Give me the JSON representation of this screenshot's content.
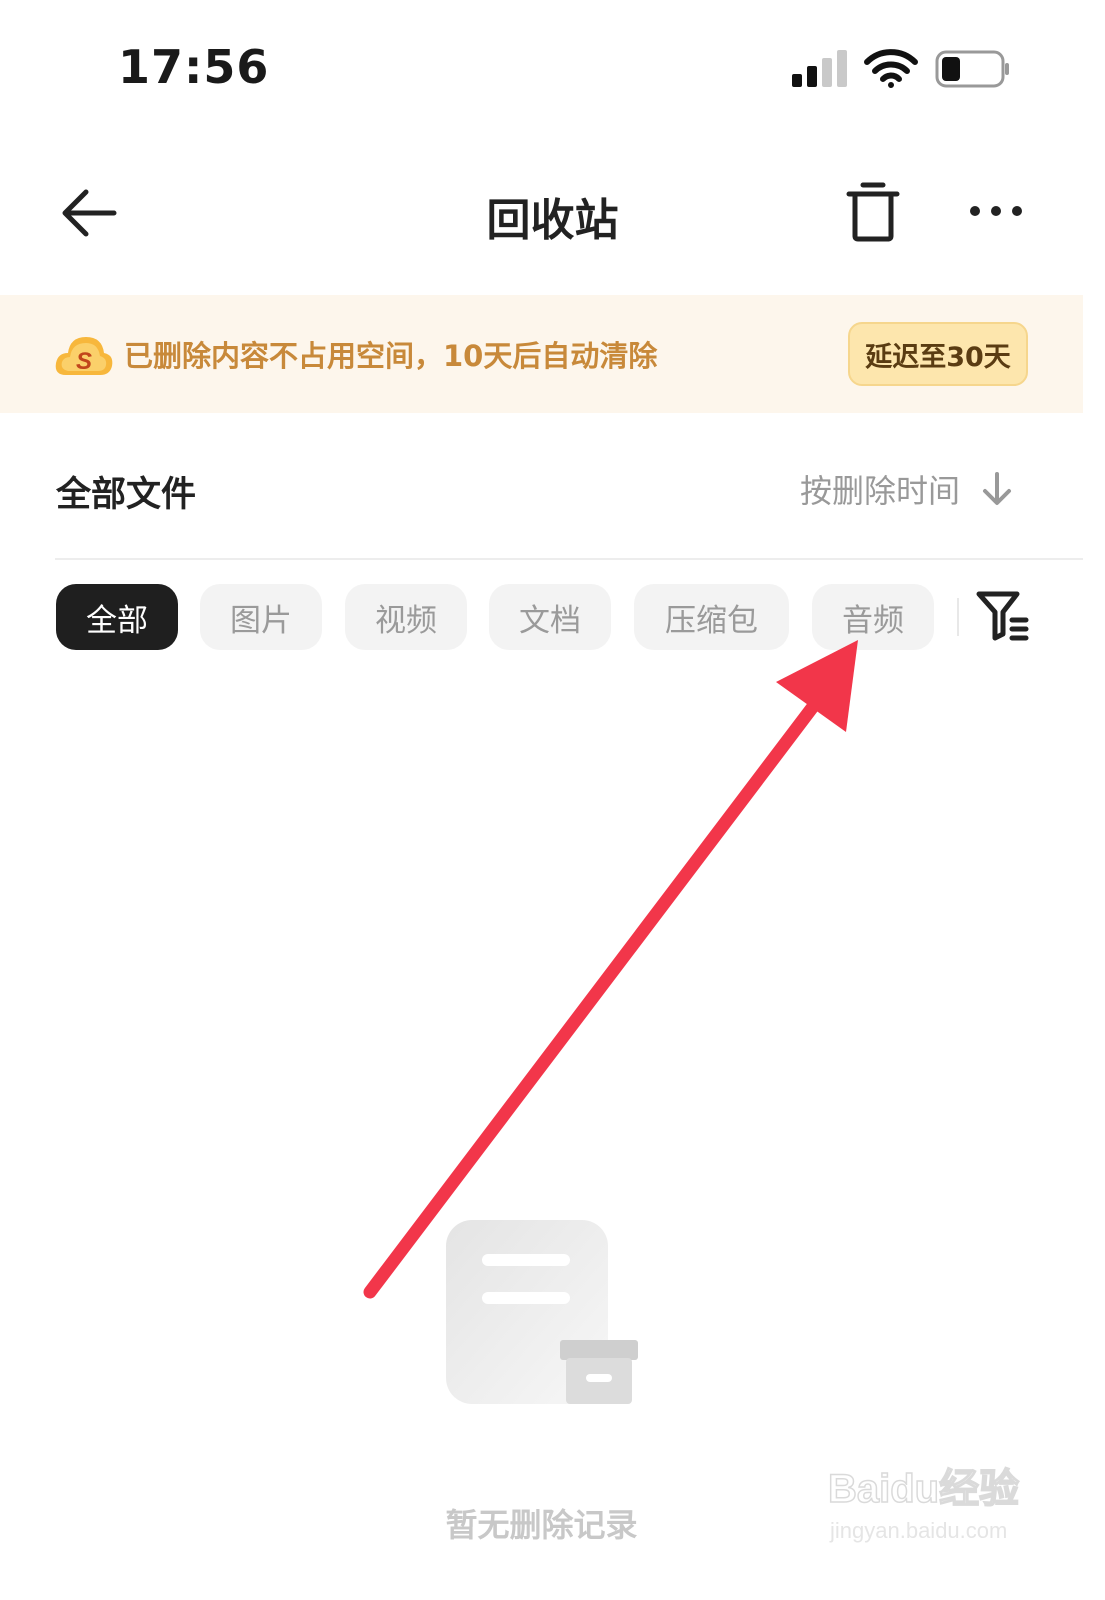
{
  "status_bar": {
    "time": "17:56",
    "icons": [
      "cellular-signal-icon",
      "wifi-icon",
      "battery-icon"
    ]
  },
  "nav": {
    "title": "回收站",
    "back_icon": "arrow-left-icon",
    "trash_icon": "trash-icon",
    "more_icon": "more-horizontal-icon"
  },
  "banner": {
    "icon": "cloud-s-logo-icon",
    "text": "已删除内容不占用空间，10天后自动清除",
    "button_label": "延迟至30天",
    "text_color": "#c8893a",
    "background": "#fdf6ec",
    "button_background": "#fde6ad"
  },
  "section": {
    "title": "全部文件",
    "sort_label": "按删除时间",
    "sort_icon": "arrow-down-icon"
  },
  "filters": {
    "chips": [
      {
        "label": "全部",
        "active": true
      },
      {
        "label": "图片",
        "active": false
      },
      {
        "label": "视频",
        "active": false
      },
      {
        "label": "文档",
        "active": false
      },
      {
        "label": "压缩包",
        "active": false
      },
      {
        "label": "音频",
        "active": false
      }
    ],
    "filter_icon": "filter-list-icon"
  },
  "empty_state": {
    "icon": "empty-document-box-icon",
    "text": "暂无删除记录"
  },
  "annotation": {
    "icon": "red-arrow-icon",
    "color": "#f2364a"
  },
  "watermark": {
    "brand": "Baidu经验",
    "url": "jingyan.baidu.com"
  }
}
